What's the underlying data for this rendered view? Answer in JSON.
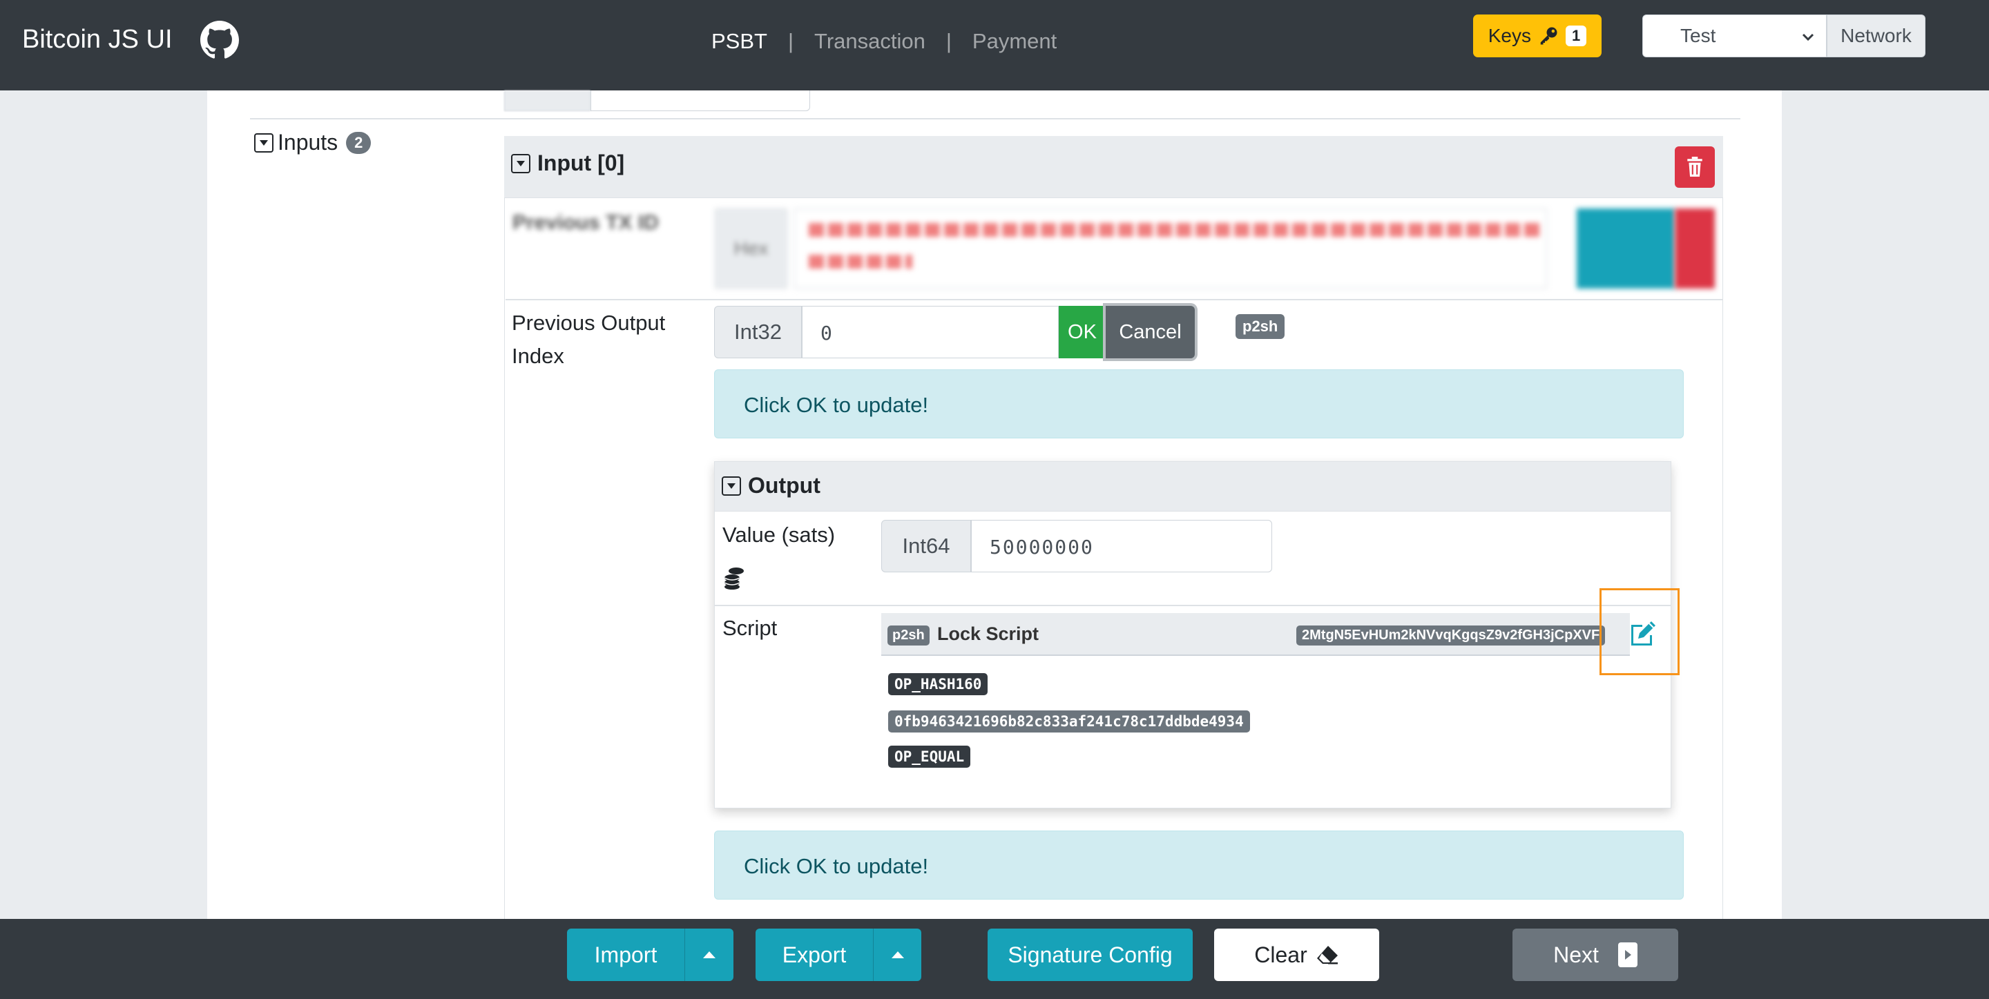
{
  "navbar": {
    "brand": "Bitcoin JS UI",
    "links": [
      {
        "label": "PSBT",
        "active": true
      },
      {
        "label": "Transaction",
        "active": false
      },
      {
        "label": "Payment",
        "active": false
      }
    ],
    "separator": "|",
    "keys_label": "Keys",
    "keys_count": "1",
    "network_value": "Test",
    "network_label": "Network"
  },
  "inputs": {
    "label": "Inputs",
    "count": "2"
  },
  "input0": {
    "title": "Input [0]",
    "prev_output_index_label": "Previous Output Index",
    "index_type": "Int32",
    "index_value": "0",
    "ok_label": "OK",
    "cancel_label": "Cancel",
    "script_type": "p2sh",
    "update_msg_1": "Click OK to update!",
    "update_msg_2": "Click OK to update!"
  },
  "output": {
    "title": "Output",
    "value_label": "Value (sats)",
    "value_type": "Int64",
    "value": "50000000",
    "script_label": "Script",
    "lock_script_type": "p2sh",
    "lock_script_title": "Lock Script",
    "address": "2MtgN5EvHUm2kNVvqKgqsZ9v2fGH3jCpXVF",
    "ops": {
      "op1": "OP_HASH160",
      "hash": "0fb9463421696b82c833af241c78c17ddbde4934",
      "op2": "OP_EQUAL"
    }
  },
  "toolbar": {
    "import_label": "Import",
    "export_label": "Export",
    "signature_label": "Signature Config",
    "clear_label": "Clear",
    "next_label": "Next"
  },
  "colors": {
    "navbar_bg": "#343a40",
    "info": "#17a2b8",
    "warning": "#ffc107",
    "danger": "#dc3545",
    "success": "#28a745",
    "secondary": "#6c757d",
    "highlight": "#f7931a"
  }
}
